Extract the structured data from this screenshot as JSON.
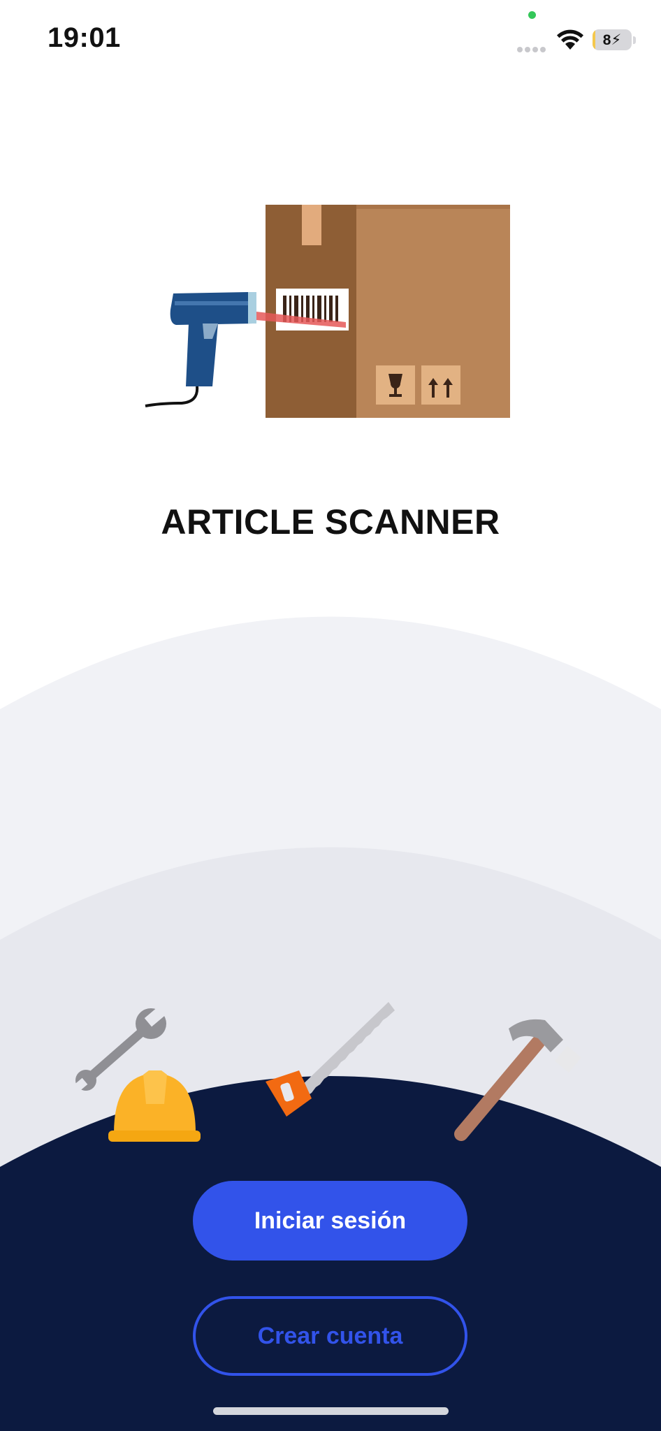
{
  "status_bar": {
    "time": "19:01",
    "battery_level": "8",
    "battery_charging": true
  },
  "app": {
    "title": "ARTICLE SCANNER"
  },
  "illustration": {
    "hero": "barcode-scanner-box-illustration",
    "tools": [
      "wrench-icon",
      "hard-hat-icon",
      "hand-saw-icon",
      "hammer-icon"
    ]
  },
  "actions": {
    "login_label": "Iniciar sesión",
    "create_account_label": "Crear cuenta"
  },
  "colors": {
    "primary": "#3253ea",
    "dark_background": "#0c1a40",
    "light_curve": "#f1f2f6",
    "mid_curve": "#e7e8ee"
  }
}
